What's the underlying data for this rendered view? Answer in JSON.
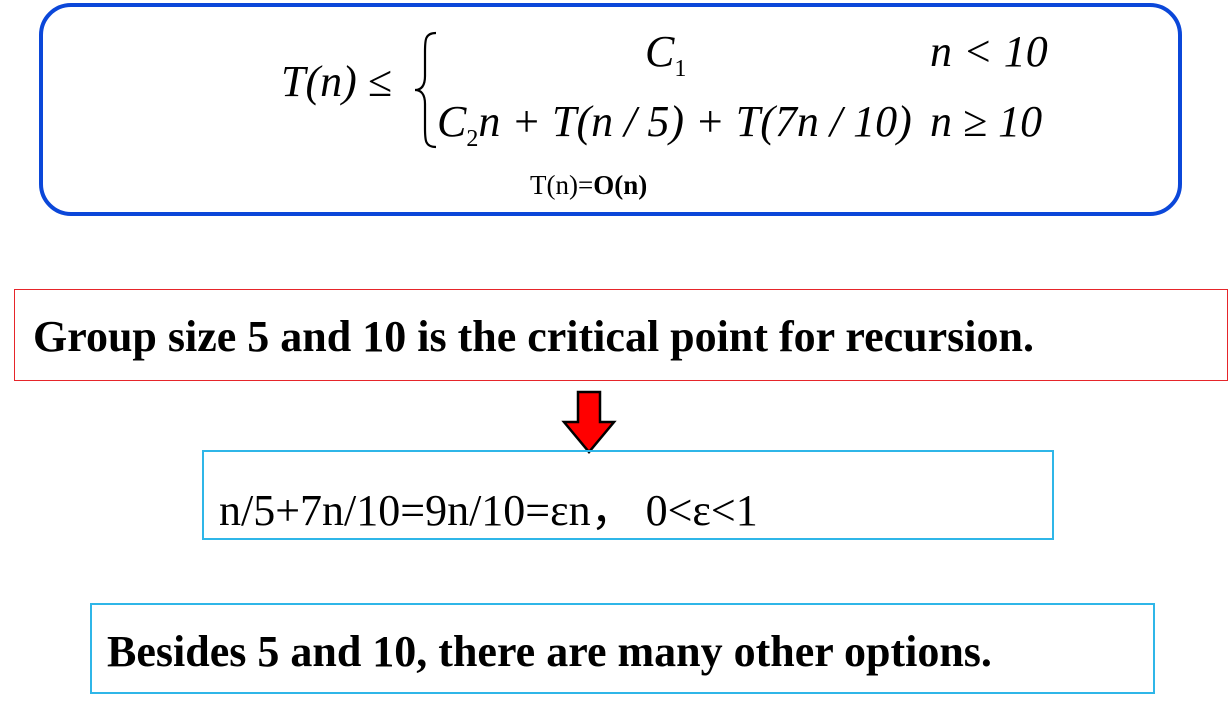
{
  "formula": {
    "lhs": "T(n) ≤",
    "case1": {
      "expr_base": "C",
      "expr_sub": "1",
      "cond": "n < 10"
    },
    "case2": {
      "c_base": "C",
      "c_sub": "2",
      "expr_rest": "n + T(n / 5) + T(7n / 10)",
      "cond": "n ≥ 10"
    },
    "result_plain": "T(n)=",
    "result_bold": "O(n)"
  },
  "critical_note": "Group size 5  and 10 is the critical point for recursion.",
  "epsilon_line": "n/5+7n/10=9n/10=εn， 0<ε<1",
  "options_note": "Besides 5 and 10, there are many other options.",
  "colors": {
    "formula_border": "#0b47d9",
    "critical_border": "#e6252a",
    "arrow_fill": "#ff0000",
    "info_border": "#2fb6e8"
  }
}
